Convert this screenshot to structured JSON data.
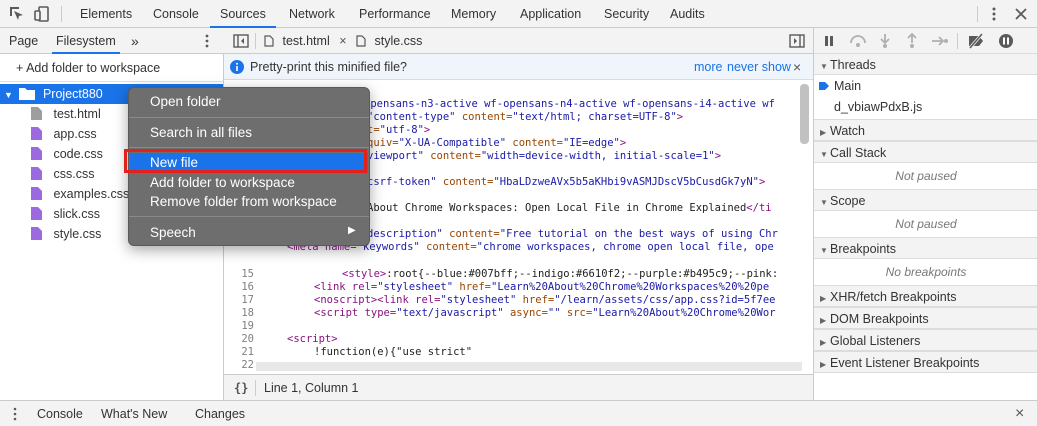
{
  "toolbar": {
    "tabs": [
      "Elements",
      "Console",
      "Sources",
      "Network",
      "Performance",
      "Memory",
      "Application",
      "Security",
      "Audits"
    ],
    "active_tab": "Sources"
  },
  "left_panel": {
    "tabs": [
      "Page",
      "Filesystem"
    ],
    "active_tab": "Filesystem",
    "more_label": "»",
    "add_folder": "+ Add folder to workspace",
    "project": "Project880",
    "files": [
      "test.html",
      "app.css",
      "code.css",
      "css.css",
      "examples.css",
      "slick.css",
      "style.css"
    ]
  },
  "editor": {
    "tabs": [
      {
        "name": "test.html",
        "close": "×"
      },
      {
        "name": "style.css",
        "close": ""
      }
    ],
    "infobar": {
      "message": "Pretty-print this minified file?",
      "more": "more",
      "never_show": "never show",
      "close": "×"
    },
    "line_numbers": [
      "15",
      "16",
      "17",
      "18",
      "19",
      "20",
      "21",
      "22"
    ],
    "status": "Line 1, Column 1",
    "status_icon": "{}"
  },
  "code": {
    "l1": "opensans-n3-active wf-opensans-n4-active wf-opensans-i4-active wf",
    "l2a": "\"content-type\"",
    "l2b": " content=",
    "l2c": "\"text/html; charset=UTF-8\"",
    "l2d": ">",
    "l3a": "t=",
    "l3b": "\"utf-8\"",
    "l3c": ">",
    "l4a": "quiv=",
    "l4b": "\"X-UA-Compatible\"",
    "l4c": " content=",
    "l4d": "\"IE=edge\"",
    "l4e": ">",
    "l5a": "viewport\"",
    "l5b": " content=",
    "l5c": "\"width=device-width, initial-scale=1\"",
    "l5d": ">",
    "l6a": "csrf-token\"",
    "l6b": " content=",
    "l6c": "\"HbaLDzweAVx5b5aKHbi9vASMJDscV5bCusdGk7yN\"",
    "l6d": ">",
    "l7a": "About Chrome Workspaces: Open Local File in Chrome Explained",
    "l7b": "</ti",
    "l8a": "description\"",
    "l8b": " content=",
    "l8c": "\"Free tutorial on the best ways of using Chr",
    "l9a": "<meta name=",
    "l9b": "\"keywords\"",
    "l9c": " content=",
    "l9d": "\"chrome workspaces, chrome open local file, ope",
    "l15a": "<style>",
    "l15b": ":root{--blue:#007bff;--indigo:#6610f2;--purple:#b495c9;--pink:",
    "l16a": "<link rel=",
    "l16b": "\"stylesheet\"",
    "l16c": " href=",
    "l16d": "\"Learn%20About%20Chrome%20Workspaces%20%20pe",
    "l17a": "<noscript><link rel=",
    "l17b": "\"stylesheet\"",
    "l17c": " href=",
    "l17d": "\"/learn/assets/css/app.css?id=5f7ee",
    "l18a": "<script type=",
    "l18b": "\"text/javascript\"",
    "l18c": " async=",
    "l18d": "\"\"",
    "l18e": " src=",
    "l18f": "\"Learn%20About%20Chrome%20Wor",
    "l20": "<script>",
    "l21": "!function(e){\"use strict\""
  },
  "context_menu": {
    "items": [
      "Open folder",
      "Search in all files",
      "New file",
      "Add folder to workspace",
      "Remove folder from workspace",
      "Speech"
    ],
    "highlighted": "New file",
    "submenu_arrow": "▶"
  },
  "debugger": {
    "threads_title": "Threads",
    "threads": [
      "Main",
      "d_vbiawPdxB.js"
    ],
    "sections": [
      "Watch",
      "Call Stack",
      "Scope",
      "Breakpoints",
      "XHR/fetch Breakpoints",
      "DOM Breakpoints",
      "Global Listeners",
      "Event Listener Breakpoints"
    ],
    "not_paused": "Not paused",
    "no_breakpoints": "No breakpoints"
  },
  "drawer": {
    "tabs": [
      "Console",
      "What's New",
      "Changes"
    ],
    "close": "×"
  },
  "colors": {
    "accent": "#1a73e8",
    "menu_bg": "#6e6e6e",
    "highlight_frame": "#e3201b",
    "folder": "#1a73e8",
    "css_file": "#9c6ae0",
    "html_file": "#9e9e9e"
  }
}
